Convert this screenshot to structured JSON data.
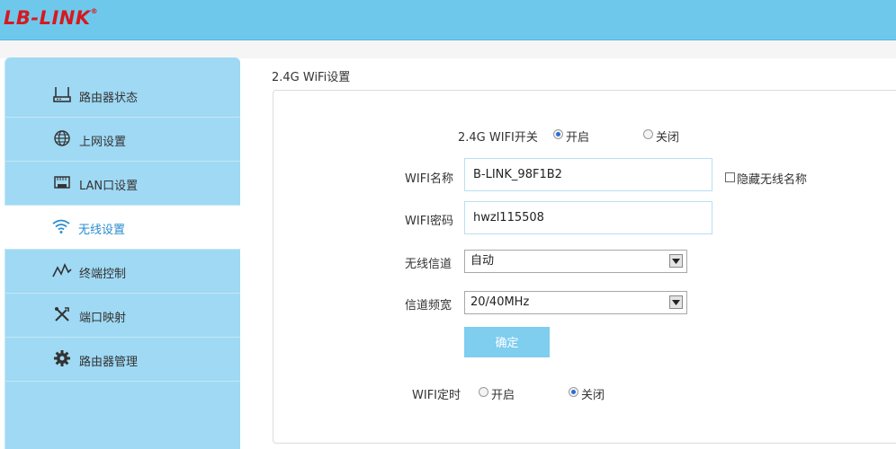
{
  "brand": {
    "logo_text": "LB-LINK",
    "trademark": "®",
    "accent": "#d7191f",
    "header_bg": "#6ec8ec"
  },
  "sidebar": {
    "bg": "#9fd9f4",
    "items": [
      {
        "label": "路由器状态",
        "icon": "router-icon"
      },
      {
        "label": "上网设置",
        "icon": "globe-icon"
      },
      {
        "label": "LAN口设置",
        "icon": "lan-port-icon"
      },
      {
        "label": "无线设置",
        "icon": "wifi-icon",
        "active": true
      },
      {
        "label": "终端控制",
        "icon": "activity-icon"
      },
      {
        "label": "端口映射",
        "icon": "tools-icon"
      },
      {
        "label": "路由器管理",
        "icon": "gear-icon"
      }
    ]
  },
  "main": {
    "title": "2.4G WiFi设置",
    "wifi_switch": {
      "label": "2.4G WIFI开关",
      "on_label": "开启",
      "off_label": "关闭",
      "selected": "on"
    },
    "ssid": {
      "label": "WIFI名称",
      "value": "B-LINK_98F1B2",
      "hide_label": "隐藏无线名称",
      "hide_checked": false
    },
    "password": {
      "label": "WIFI密码",
      "value": "hwzl115508"
    },
    "channel": {
      "label": "无线信道",
      "value": "自动"
    },
    "bandwidth": {
      "label": "信道频宽",
      "value": "20/40MHz"
    },
    "submit_label": "确定",
    "wifi_timer": {
      "label": "WIFI定时",
      "on_label": "开启",
      "off_label": "关闭",
      "selected": "off"
    }
  }
}
